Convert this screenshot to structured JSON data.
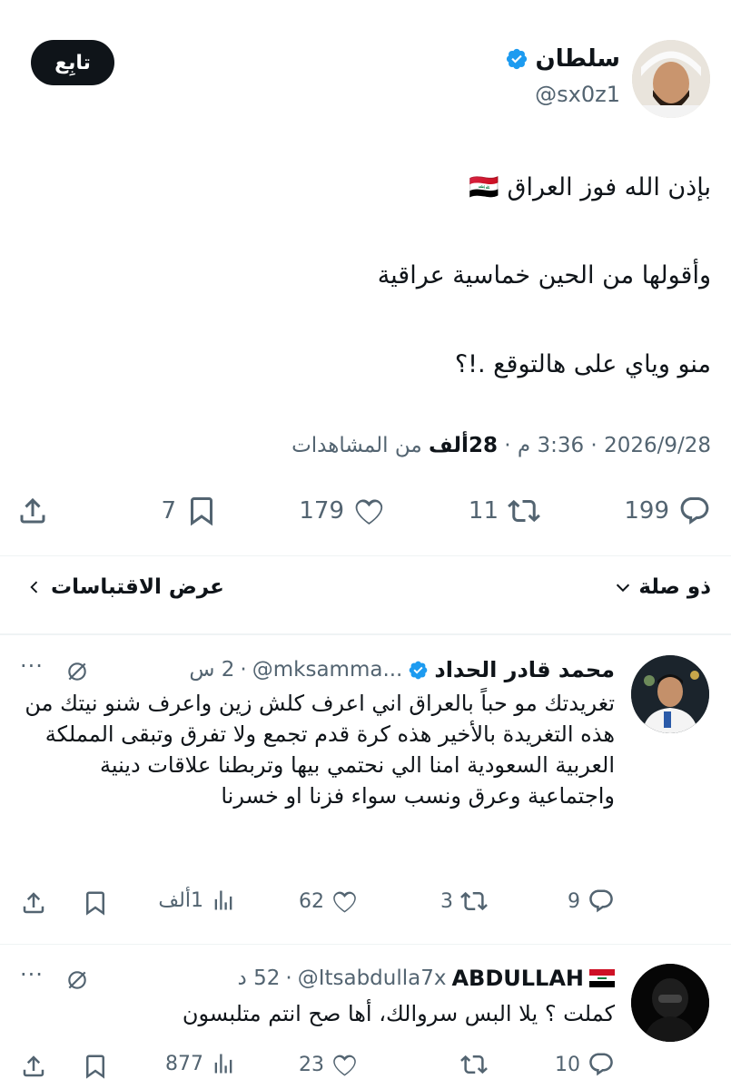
{
  "main_tweet": {
    "author_name": "سلطان",
    "handle": "@sx0z1",
    "follow_label": "تابِع",
    "lines": [
      "بإذن الله فوز العراق 🇮🇶",
      "وأقولها من الحين خماسية عراقية",
      "منو وياي على هالتوقع .!؟"
    ],
    "date": "2026/9/28",
    "time": "3:36 م",
    "views_count": "28ألف",
    "views_label": "من المشاهدات",
    "stats": {
      "replies": "199",
      "retweets": "11",
      "likes": "179",
      "bookmarks": "7"
    }
  },
  "sort": {
    "label": "ذو صلة",
    "quotes_label": "عرض الاقتباسات"
  },
  "replies": [
    {
      "name": "محمد قادر الحداد",
      "handle": "@mksamma...",
      "time": "2 س",
      "text": "تغريدتك مو حباً بالعراق اني اعرف كلش زين واعرف شنو نيتك من هذه التغريدة بالأخير هذه كرة قدم تجمع ولا تفرق وتبقى المملكة العربية السعودية امنا الي نحتمي بيها وتربطنا علاقات دينية واجتماعية وعرق ونسب سواء فزنا او خسرنا",
      "stats": {
        "replies": "9",
        "retweets": "3",
        "likes": "62",
        "views": "1ألف"
      }
    },
    {
      "name": "ABDULLAH",
      "handle": "@Itsabdulla7x",
      "time": "52 د",
      "text": "كملت ؟ يلا البس سروالك، أها صح انتم متلبسون",
      "stats": {
        "replies": "10",
        "retweets": "",
        "likes": "23",
        "views": "877"
      }
    }
  ],
  "colors": {
    "verified": "#1d9bf0",
    "muted": "#536471",
    "text": "#0f1419"
  }
}
